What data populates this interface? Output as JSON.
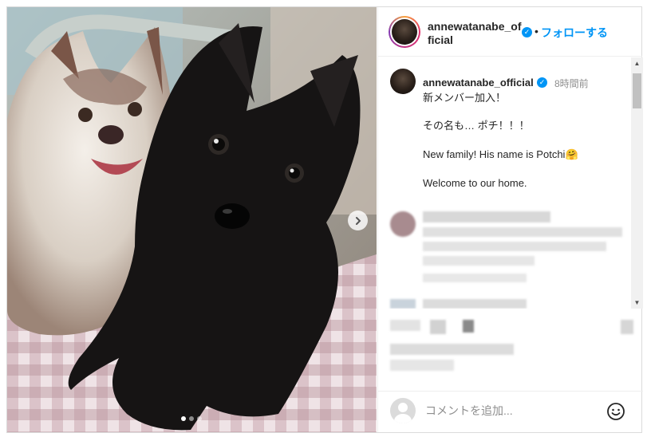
{
  "header": {
    "username": "annewatanabe_official",
    "separator": "•",
    "follow_label": "フォローする"
  },
  "caption": {
    "username": "annewatanabe_official",
    "time": "8時間前",
    "lines": [
      "新メンバー加入！",
      "その名も… ポチ！！！",
      "New family! His name is Potchi🤗",
      "Welcome to our home."
    ]
  },
  "comment": {
    "placeholder": "コメントを追加..."
  },
  "carousel": {
    "slide_count": 3,
    "active_slide": 1
  },
  "colors": {
    "accent": "#0095f6",
    "border": "#dbdbdb",
    "text": "#262626",
    "muted": "#8e8e8e"
  },
  "icons": {
    "verified": "verified-badge-icon",
    "next": "chevron-right-icon",
    "emoji": "smiley-icon",
    "user": "default-avatar-icon"
  }
}
